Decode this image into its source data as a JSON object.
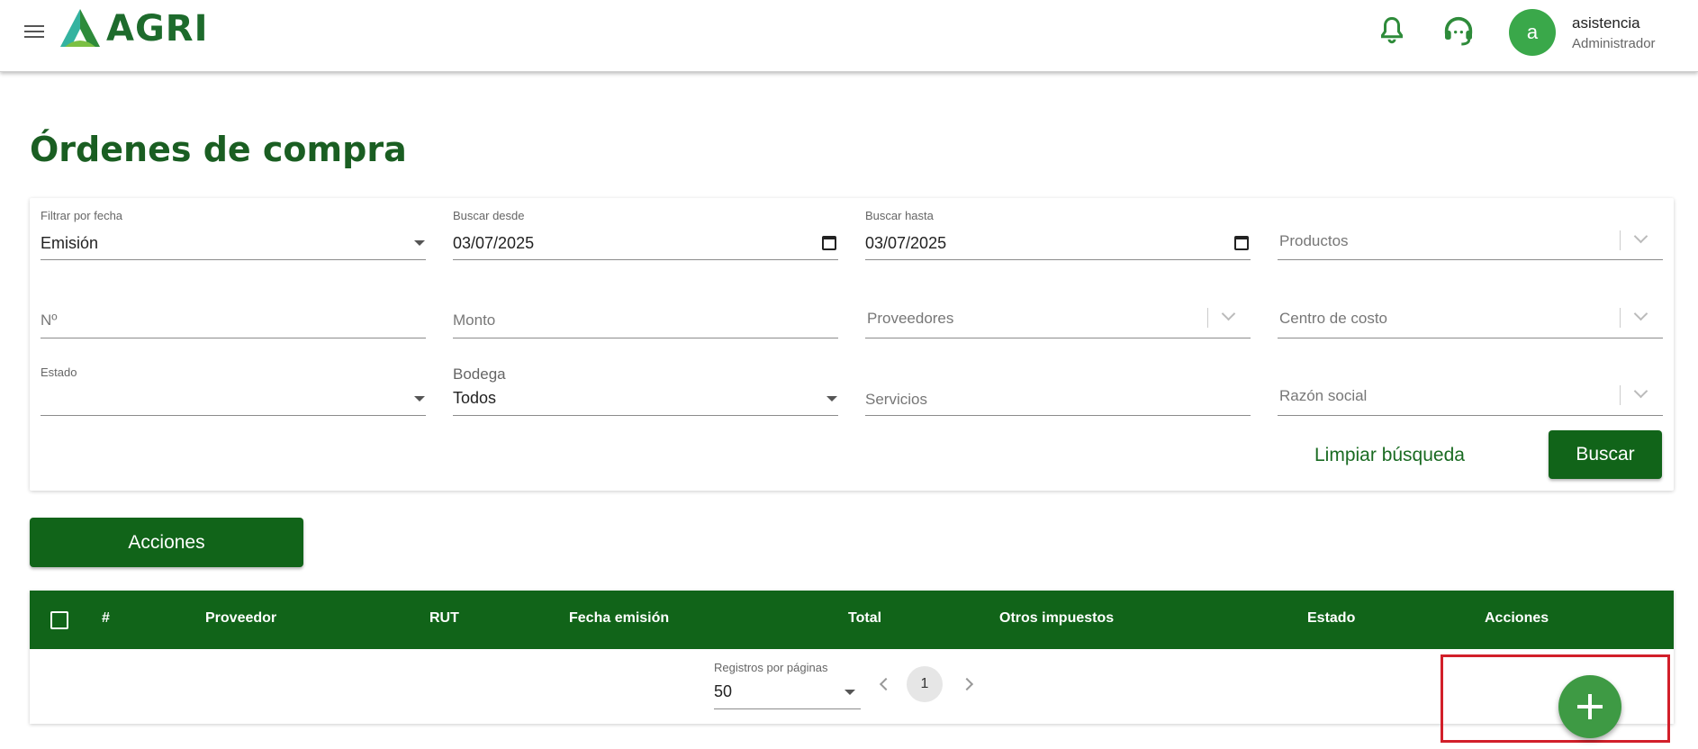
{
  "header": {
    "logo_text": "AGRI",
    "user_initial": "a",
    "user_name": "asistencia",
    "user_role": "Administrador"
  },
  "page": {
    "title": "Órdenes de compra"
  },
  "filters": {
    "filter_date_label": "Filtrar por fecha",
    "filter_date_value": "Emisión",
    "from_label": "Buscar desde",
    "from_value": "03/07/2025",
    "to_label": "Buscar hasta",
    "to_value": "03/07/2025",
    "products_placeholder": "Productos",
    "number_placeholder": "Nº",
    "amount_placeholder": "Monto",
    "suppliers_placeholder": "Proveedores",
    "cost_center_placeholder": "Centro de costo",
    "status_label": "Estado",
    "status_value": "",
    "warehouse_label": "Bodega",
    "warehouse_value": "Todos",
    "services_placeholder": "Servicios",
    "business_name_placeholder": "Razón social",
    "clear_label": "Limpiar búsqueda",
    "search_label": "Buscar"
  },
  "actions_label": "Acciones",
  "table": {
    "columns": [
      "#",
      "Proveedor",
      "RUT",
      "Fecha emisión",
      "Total",
      "Otros impuestos",
      "Estado",
      "Acciones"
    ],
    "rows": []
  },
  "pagination": {
    "per_page_label": "Registros por páginas",
    "per_page_value": "50",
    "current_page": "1"
  },
  "colors": {
    "primary": "#116419",
    "title": "#1a5e22",
    "fab": "#3e9a44",
    "avatar": "#3aa84a",
    "highlight": "#d21f2a"
  },
  "icons": [
    "menu-icon",
    "bell-icon",
    "headset-icon",
    "calendar-icon",
    "chevron-down-icon",
    "plus-icon"
  ]
}
